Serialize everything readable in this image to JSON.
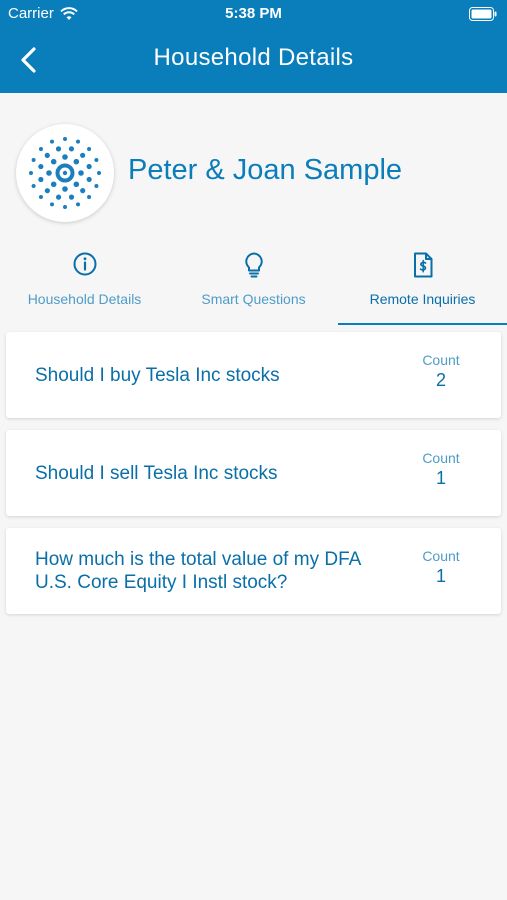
{
  "status_bar": {
    "carrier": "Carrier",
    "time": "5:38 PM"
  },
  "nav": {
    "title": "Household Details",
    "back_icon": "chevron-left-icon"
  },
  "household": {
    "name": "Peter & Joan Sample",
    "avatar_icon": "dotted-target-logo-icon"
  },
  "tabs": [
    {
      "label": "Household Details",
      "icon": "info-circle-icon",
      "active": false
    },
    {
      "label": "Smart Questions",
      "icon": "lightbulb-icon",
      "active": false
    },
    {
      "label": "Remote Inquiries",
      "icon": "dollar-document-icon",
      "active": true
    }
  ],
  "inquiries": [
    {
      "question": "Should I buy Tesla Inc stocks",
      "count_label": "Count",
      "count": "2"
    },
    {
      "question": "Should I sell Tesla Inc stocks",
      "count_label": "Count",
      "count": "1"
    },
    {
      "question": "How much is the total value of my DFA U.S. Core Equity I Instl stock?",
      "count_label": "Count",
      "count": "1"
    }
  ],
  "colors": {
    "brand": "#0a7dbb",
    "text_accent": "#0a6fa8",
    "muted_accent": "#4f9cc7",
    "background": "#f6f6f6"
  }
}
